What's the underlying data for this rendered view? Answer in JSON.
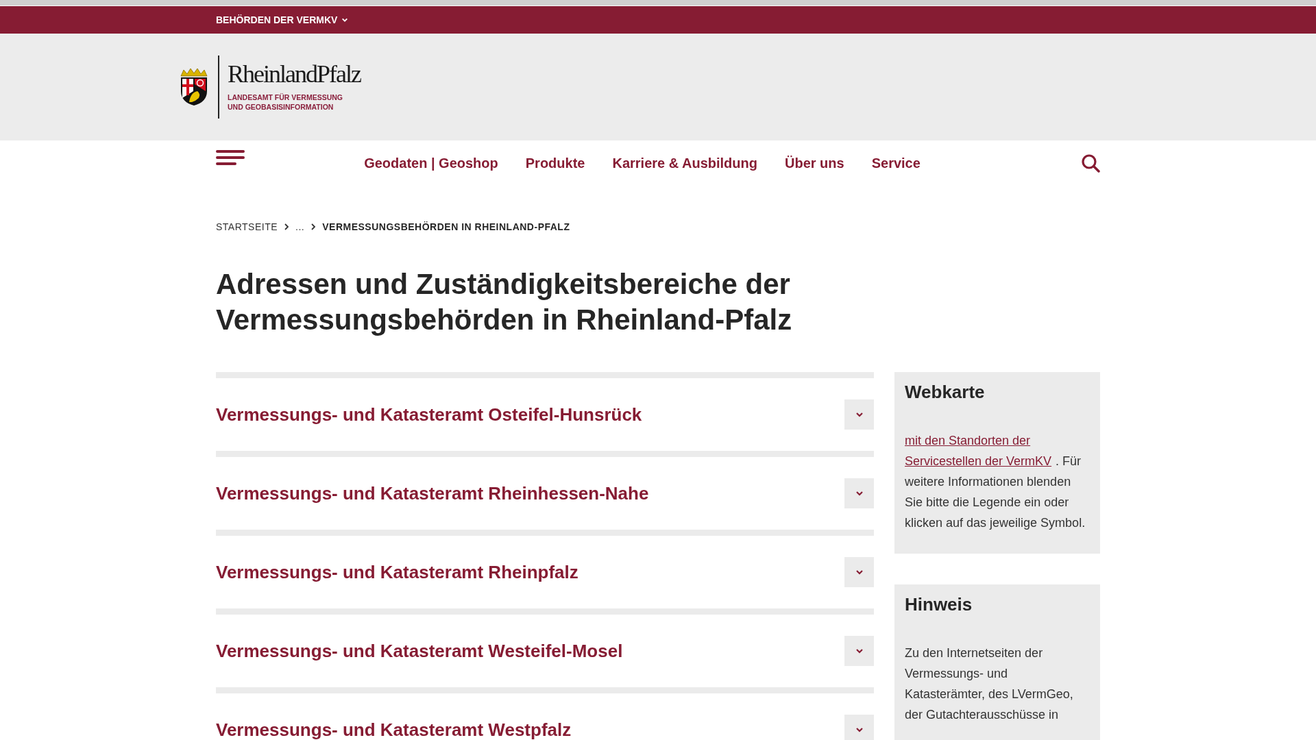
{
  "top_bar": {
    "label": "BEHÖRDEN DER VERMKV"
  },
  "logo": {
    "wordmark": "RheinlandPfalz",
    "subtitle_lines": [
      "LANDESAMT FÜR VERMESSUNG",
      "UND GEOBASISINFORMATION"
    ]
  },
  "nav": {
    "items": [
      "Geodaten | Geoshop",
      "Produkte",
      "Karriere & Ausbildung",
      "Über uns",
      "Service"
    ]
  },
  "breadcrumb": [
    {
      "label": "STARTSEITE",
      "current": false
    },
    {
      "label": "...",
      "current": false
    },
    {
      "label": "VERMESSUNGSBEHÖRDEN IN RHEINLAND-PFALZ",
      "current": true
    }
  ],
  "heading": "Adressen und Zuständigkeitsbereiche der Vermessungsbehörden in Rheinland-Pfalz",
  "accordion": [
    {
      "title": "Vermessungs- und Katasteramt Osteifel-Hunsrück",
      "expanded": false
    },
    {
      "title": "Vermessungs- und Katasteramt Rheinhessen-Nahe",
      "expanded": false
    },
    {
      "title": "Vermessungs- und Katasteramt Rheinpfalz",
      "expanded": false
    },
    {
      "title": "Vermessungs- und Katasteramt Westeifel-Mosel",
      "expanded": false
    },
    {
      "title": "Vermessungs- und Katasteramt Westpfalz",
      "expanded": false
    }
  ],
  "sidebar": [
    {
      "title": "Webkarte",
      "link": "mit den Standorten der Servicestellen der VermKV",
      "text": ". Für weitere Informationen blenden Sie bitte die Legende ein oder klicken auf das jeweilige Symbol."
    },
    {
      "title": "Hinweis",
      "text": "Zu den Internetseiten der Vermessungs- und Katasterämter, des LVermGeo, der Gutachterausschüsse in"
    }
  ]
}
